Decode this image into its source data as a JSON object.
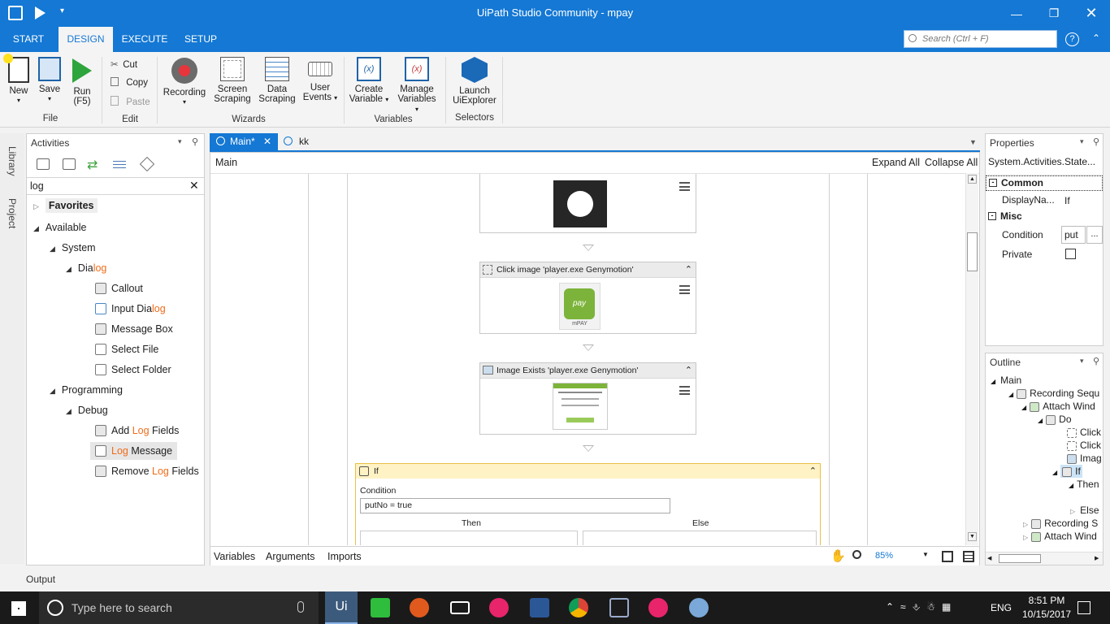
{
  "window": {
    "title": "UiPath Studio Community - mpay"
  },
  "ribbon_tabs": [
    {
      "label": "START"
    },
    {
      "label": "DESIGN"
    },
    {
      "label": "EXECUTE"
    },
    {
      "label": "SETUP"
    }
  ],
  "search": {
    "placeholder": "Search (Ctrl + F)"
  },
  "ribbon": {
    "new": "New",
    "save": "Save",
    "run": "Run",
    "run_key": "(F5)",
    "cut": "Cut",
    "copy": "Copy",
    "paste": "Paste",
    "recording": "Recording",
    "screen_scraping_1": "Screen",
    "screen_scraping_2": "Scraping",
    "data_scraping_1": "Data",
    "data_scraping_2": "Scraping",
    "user_events_1": "User",
    "user_events_2": "Events",
    "create_variable_1": "Create",
    "create_variable_2": "Variable",
    "manage_variables_1": "Manage",
    "manage_variables_2": "Variables",
    "launch_1": "Launch",
    "launch_2": "UiExplorer",
    "groups": {
      "file": "File",
      "edit": "Edit",
      "wizards": "Wizards",
      "variables": "Variables",
      "selectors": "Selectors"
    }
  },
  "side_tabs": {
    "library": "Library",
    "project": "Project"
  },
  "activities": {
    "title": "Activities",
    "filter": "log",
    "favorites": "Favorites",
    "available": "Available",
    "system": "System",
    "dialog_a": "Dia",
    "dialog_b": "log",
    "callout": "Callout",
    "input_dialog_a": "Input Dia",
    "input_dialog_b": "log",
    "message_box": "Message Box",
    "select_file": "Select File",
    "select_folder": "Select Folder",
    "programming": "Programming",
    "debug": "Debug",
    "add_log_a": "Add ",
    "add_log_b": "Log",
    "add_log_c": " Fields",
    "log_message_a": "Log",
    "log_message_b": " Message",
    "remove_log_a": "Remove ",
    "remove_log_b": "Log",
    "remove_log_c": " Fields"
  },
  "doc_tabs": [
    {
      "label": "Main*"
    },
    {
      "label": "kk"
    }
  ],
  "designer": {
    "breadcrumb": "Main",
    "expand_all": "Expand All",
    "collapse_all": "Collapse All",
    "click_image_title": "Click image 'player.exe Genymotion'",
    "mpay_caption": "mPAY",
    "image_exists_title": "Image Exists 'player.exe Genymotion'",
    "if_title": "If",
    "condition_label": "Condition",
    "condition_value": "putNo = true",
    "then_label": "Then",
    "else_label": "Else"
  },
  "bottom_tabs": {
    "variables": "Variables",
    "arguments": "Arguments",
    "imports": "Imports"
  },
  "zoom": "85%",
  "properties": {
    "title": "Properties",
    "type": "System.Activities.State...",
    "common": "Common",
    "display_name_label": "DisplayNa...",
    "display_name_value": "If",
    "misc": "Misc",
    "condition_label": "Condition",
    "condition_value": "put",
    "private_label": "Private",
    "ellipsis": "..."
  },
  "outline": {
    "title": "Outline",
    "items": [
      "Main",
      "Recording Sequ",
      "Attach Wind",
      "Do",
      "Click",
      "Click",
      "Imag",
      "If",
      "Then",
      "Else",
      "Recording S",
      "Attach Wind"
    ]
  },
  "output_label": "Output",
  "taskbar": {
    "search_placeholder": "Type here to search",
    "lang": "ENG",
    "time": "8:51 PM",
    "date": "10/15/2017"
  }
}
